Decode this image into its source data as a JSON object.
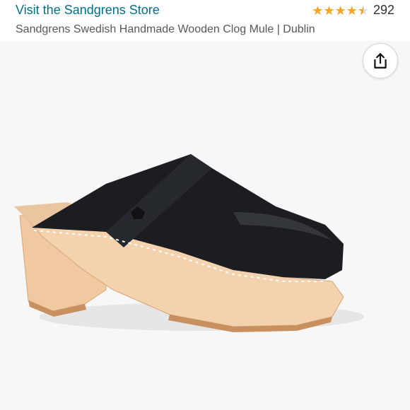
{
  "header": {
    "store_link": "Visit the Sandgrens Store",
    "rating_count": "292",
    "rating": 4.5,
    "product_title": "Sandgrens Swedish Handmade Wooden Clog Mule | Dublin"
  },
  "share": {
    "icon": "share-icon"
  },
  "product_image": {
    "subject": "black leather clog mule with wooden heel"
  },
  "colors": {
    "link": "#007185",
    "star": "#f5a623",
    "title": "#565959",
    "image_background": "#f7f7f7"
  }
}
